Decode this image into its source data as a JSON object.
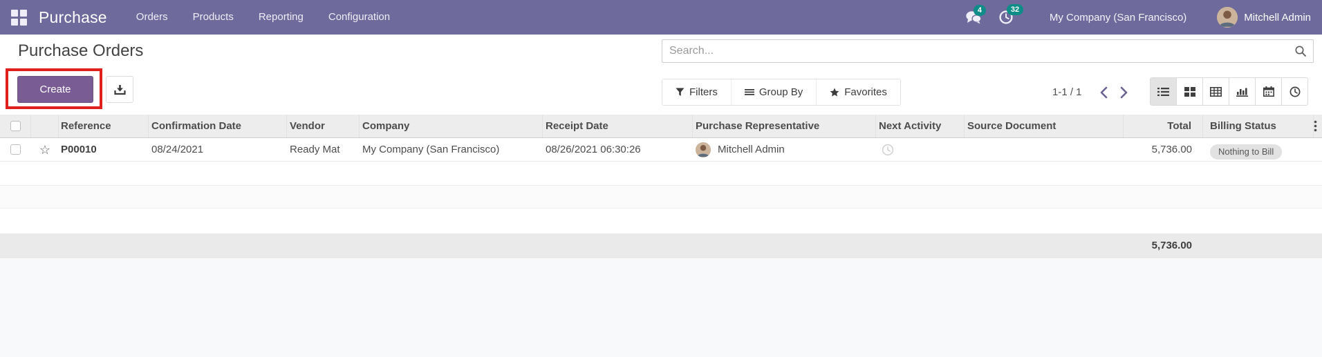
{
  "navbar": {
    "brand": "Purchase",
    "menus": [
      {
        "label": "Orders"
      },
      {
        "label": "Products"
      },
      {
        "label": "Reporting"
      },
      {
        "label": "Configuration"
      }
    ],
    "messages_badge": "4",
    "activities_badge": "32",
    "company": "My Company (San Francisco)",
    "user": "Mitchell Admin"
  },
  "control_panel": {
    "title": "Purchase Orders",
    "create_label": "Create",
    "search_placeholder": "Search...",
    "filters_label": "Filters",
    "group_by_label": "Group By",
    "favorites_label": "Favorites",
    "pager": "1-1 / 1"
  },
  "table": {
    "columns": [
      "Reference",
      "Confirmation Date",
      "Vendor",
      "Company",
      "Receipt Date",
      "Purchase Representative",
      "Next Activity",
      "Source Document",
      "Total",
      "Billing Status"
    ],
    "rows": [
      {
        "reference": "P00010",
        "confirmation_date": "08/24/2021",
        "vendor": "Ready Mat",
        "company": "My Company (San Francisco)",
        "receipt_date": "08/26/2021 06:30:26",
        "purchase_representative": "Mitchell Admin",
        "source_document": "",
        "total": "5,736.00",
        "billing_status": "Nothing to Bill"
      }
    ],
    "footer_total": "5,736.00"
  },
  "colors": {
    "navbar_bg": "#6e6a9b",
    "badge_teal": "#0e8c87",
    "primary_button": "#7a5c94",
    "annotation_red": "#e0201c",
    "header_bg": "#ededed",
    "sum_row_bg": "#eaeaea"
  }
}
